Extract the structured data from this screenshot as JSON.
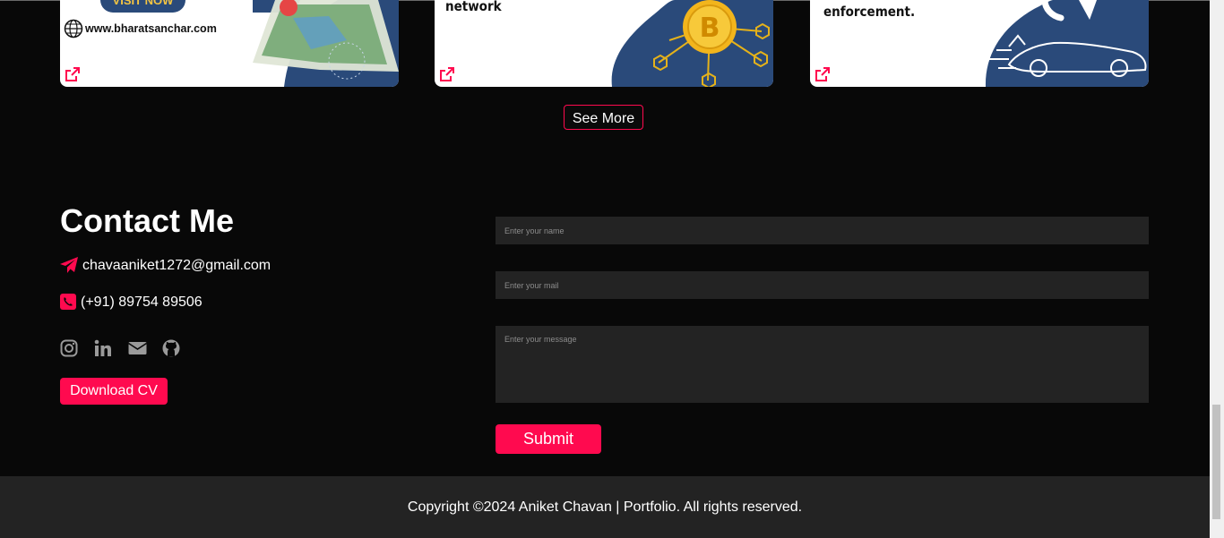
{
  "projects": {
    "cards": [
      {
        "text": "www.bharatsanchar.com",
        "visit_label": "VISIT NOW"
      },
      {
        "text": "network"
      },
      {
        "text": "enforcement."
      }
    ],
    "see_more_label": "See More"
  },
  "contact": {
    "title": "Contact Me",
    "email": "chavaaniket1272@gmail.com",
    "phone": "(+91) 89754 89506",
    "download_cv_label": "Download CV",
    "socials": [
      "instagram-icon",
      "linkedin-icon",
      "mail-icon",
      "github-icon"
    ]
  },
  "form": {
    "name_placeholder": "Enter your name",
    "mail_placeholder": "Enter your mail",
    "message_placeholder": "Enter your message",
    "submit_label": "Submit"
  },
  "footer": {
    "copyright": "Copyright ©2024 Aniket Chavan | Portfolio. All rights reserved."
  },
  "colors": {
    "accent": "#ff0a4f",
    "background": "#080808",
    "field": "#232323",
    "card_blue": "#2a4a7a"
  }
}
